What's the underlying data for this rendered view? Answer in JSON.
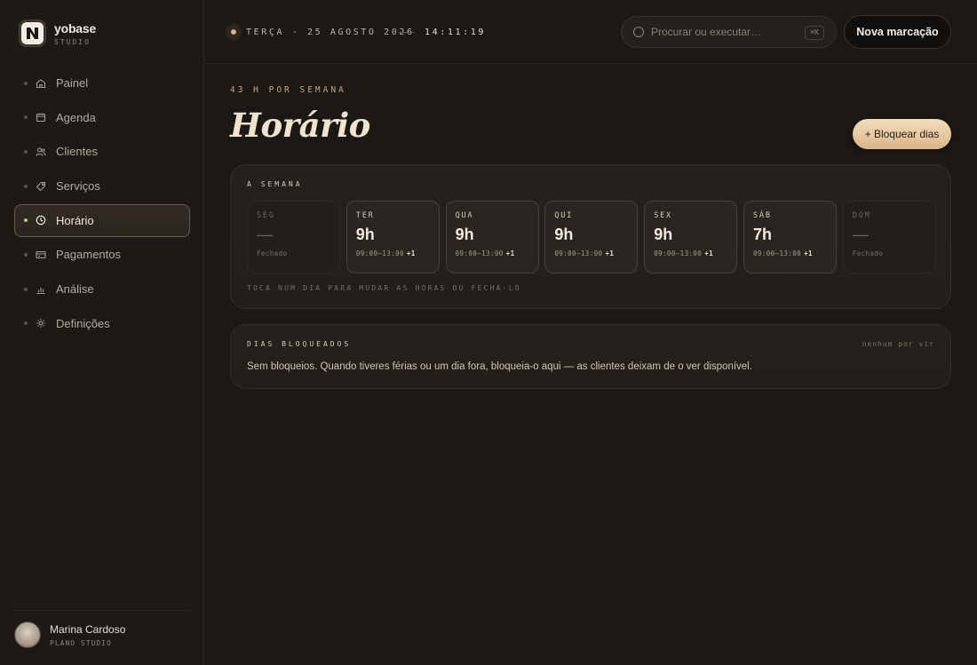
{
  "brand": {
    "name": "yobase",
    "sub": "STUDIO",
    "logo_icon": "yobase-logo-icon"
  },
  "sidebar": {
    "items": [
      {
        "label": "Painel",
        "icon": "home-icon",
        "active": false
      },
      {
        "label": "Agenda",
        "icon": "calendar-icon",
        "active": false
      },
      {
        "label": "Clientes",
        "icon": "users-icon",
        "active": false
      },
      {
        "label": "Serviços",
        "icon": "tag-icon",
        "active": false
      },
      {
        "label": "Horário",
        "icon": "clock-icon",
        "active": true
      },
      {
        "label": "Pagamentos",
        "icon": "card-icon",
        "active": false
      },
      {
        "label": "Análise",
        "icon": "bar-chart-icon",
        "active": false
      },
      {
        "label": "Definições",
        "icon": "gear-icon",
        "active": false
      }
    ]
  },
  "user": {
    "name": "Marina Cardoso",
    "plan": "PLANO STUDIO"
  },
  "topbar": {
    "date": "TERÇA · 25 AGOSTO 2026",
    "time": "14:11:19",
    "search_placeholder": "Procurar ou executar…",
    "search_shortcut": "⌘K",
    "new_button": "Nova marcação"
  },
  "main": {
    "hours_label": "43 H POR SEMANA",
    "title": "Horário",
    "block_button": "+ Bloquear dias",
    "week": {
      "label": "A SEMANA",
      "hint": "TOCA NUM DIA PARA MUDAR AS HORAS OU FECHÁ-LO",
      "days": [
        {
          "name": "SEG",
          "hours": "—",
          "range": "Fechado",
          "extra": "",
          "closed": true
        },
        {
          "name": "TER",
          "hours": "9h",
          "range": "09:00–13:00",
          "extra": "+1",
          "closed": false
        },
        {
          "name": "QUA",
          "hours": "9h",
          "range": "09:00–13:00",
          "extra": "+1",
          "closed": false
        },
        {
          "name": "QUI",
          "hours": "9h",
          "range": "09:00–13:00",
          "extra": "+1",
          "closed": false
        },
        {
          "name": "SEX",
          "hours": "9h",
          "range": "09:00–13:00",
          "extra": "+1",
          "closed": false
        },
        {
          "name": "SÁB",
          "hours": "7h",
          "range": "09:00–13:00",
          "extra": "+1",
          "closed": false
        },
        {
          "name": "DOM",
          "hours": "—",
          "range": "Fechado",
          "extra": "",
          "closed": true
        }
      ]
    },
    "blocked": {
      "label": "DIAS BLOQUEADOS",
      "meta": "nenhum por vir",
      "text": "Sem bloqueios. Quando tiveres férias ou um dia fora, bloqueia-o aqui — as clientes deixam de o ver disponível."
    }
  },
  "colors": {
    "accent": "#d9b68c",
    "background": "#1b1815",
    "title": "#f1e4cf"
  }
}
